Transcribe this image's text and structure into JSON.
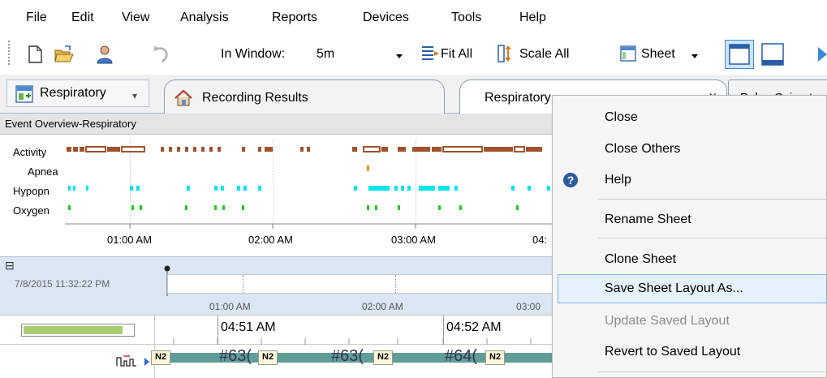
{
  "menu": {
    "items": [
      "File",
      "Edit",
      "View",
      "Analysis",
      "Reports",
      "Devices",
      "Tools",
      "Help"
    ]
  },
  "toolbar": {
    "in_window_label": "In Window:",
    "in_window_value": "5m",
    "fit_all_label": "Fit All",
    "scale_all_label": "Scale All",
    "sheet_label": "Sheet",
    "icons": [
      "new-document-icon",
      "open-folder-icon",
      "patient-icon",
      "undo-icon",
      "fit-all-icon",
      "scale-all-icon",
      "sheet-icon",
      "layout-top-icon",
      "layout-bottom-icon",
      "play-icon"
    ]
  },
  "tabs": {
    "workspace_label": "Respiratory",
    "items": [
      {
        "label": "Recording Results"
      },
      {
        "label": "Respiratory"
      },
      {
        "label": "Pulse Oximete"
      }
    ],
    "close_glyph": "×"
  },
  "overview": {
    "title": "Event Overview-Respiratory",
    "rows": [
      "Activity",
      "Apnea",
      "Hypopn",
      "Oxygen"
    ],
    "time_labels": [
      "01:00 AM",
      "02:00 AM",
      "03:00 AM",
      "04:"
    ],
    "colors": {
      "activity": "#a0522d",
      "apnea": "#ff8c1a",
      "hypopnea": "#00e5ee",
      "oxygen": "#22cc22"
    }
  },
  "navigator": {
    "collapse_glyph": "⊟",
    "start_datetime": "7/8/2015 11:32:22 PM",
    "time_labels": [
      "01:00 AM",
      "02:00 AM",
      "03:00"
    ]
  },
  "lower": {
    "time_labels": [
      "04:51 AM",
      "04:52 AM"
    ],
    "stage_labels": [
      "N2",
      "N2",
      "N2",
      "N2"
    ],
    "epoch_labels": [
      "#63(",
      "#63(",
      "#64("
    ],
    "hypnogram_color": "#5f9e96",
    "level_bar_color": "#a8cf6f"
  },
  "context_menu": {
    "items": [
      {
        "label": "Close",
        "enabled": true
      },
      {
        "label": "Close Others",
        "enabled": true
      },
      {
        "label": "Help",
        "enabled": true
      },
      {
        "label": "Rename Sheet",
        "enabled": true
      },
      {
        "label": "Clone Sheet",
        "enabled": true
      },
      {
        "label": "Save Sheet Layout As...",
        "enabled": true,
        "highlighted": true
      },
      {
        "label": "Update Saved Layout",
        "enabled": false
      },
      {
        "label": "Revert to Saved Layout",
        "enabled": true
      }
    ]
  }
}
